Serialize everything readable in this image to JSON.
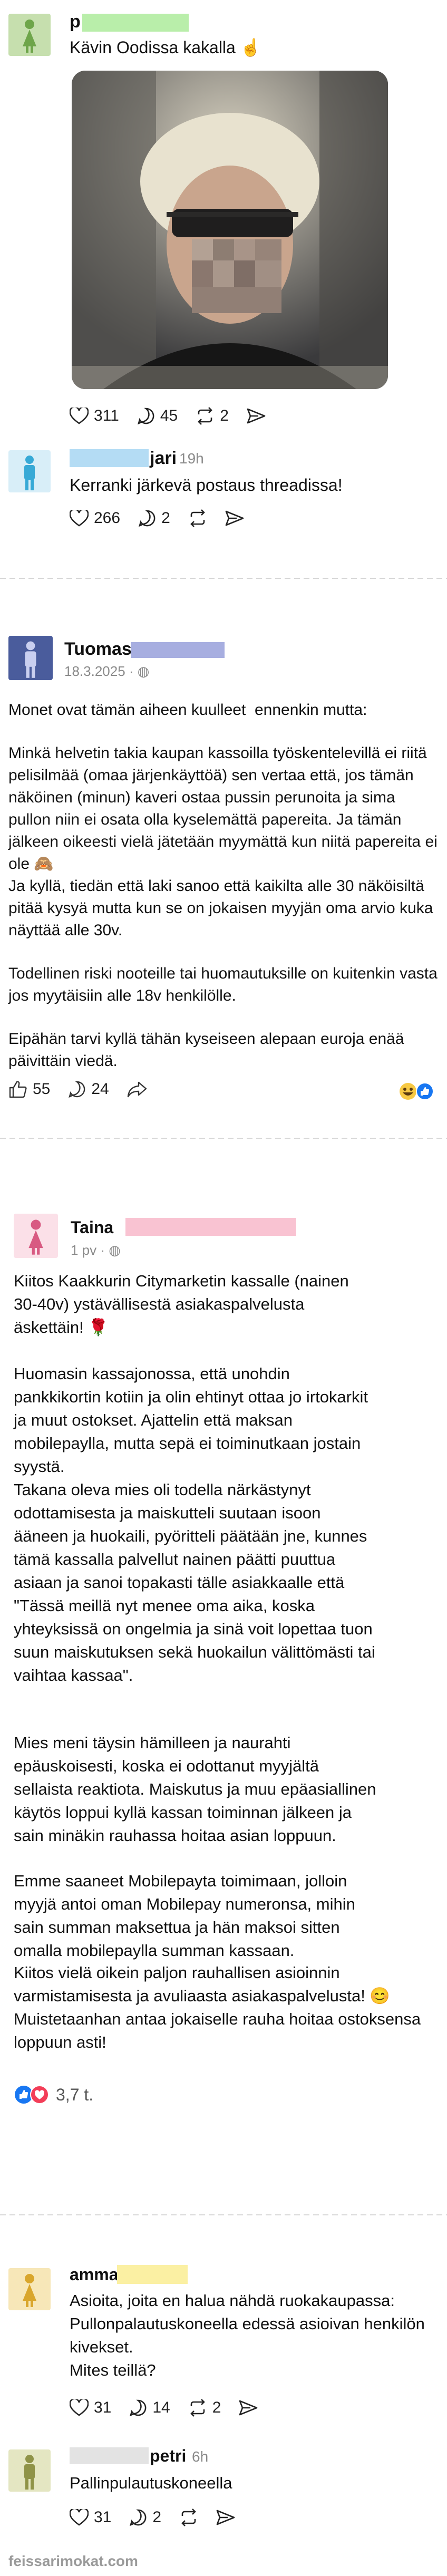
{
  "post1": {
    "name": "p",
    "text": "Kävin Oodissa kakalla ☝️",
    "likes": "311",
    "comments": "45",
    "reposts": "2"
  },
  "reply1": {
    "name": "jari",
    "time": "19h",
    "text": "Kerranki järkevä postaus threadissa!",
    "likes": "266",
    "comments": "2"
  },
  "post2": {
    "name": "Tuomas",
    "date": "18.3.2025 · ",
    "paragraphs": [
      "Monet ovat tämän aiheen kuulleet  ennenkin mutta:",
      "Minkä helvetin takia kaupan kassoilla työskentelevillä ei riitä pelisilmää (omaa järjenkäyttöä) sen vertaa että, jos tämän näköinen (minun) kaveri ostaa pussin perunoita ja sima pullon niin ei osata olla kyselemättä papereita. Ja tämän jälkeen oikeesti vielä jätetään myymättä kun niitä papereita ei ole 🙈",
      "Ja kyllä, tiedän että laki sanoo että kaikilta alle 30 näköisiltä pitää kysyä mutta kun se on jokaisen myyjän oma arvio kuka näyttää alle 30v.",
      "Todellinen riski nooteille tai huomautuksille on kuitenkin vasta jos myytäisiin alle 18v henkilölle.",
      "Eipähän tarvi kyllä tähän kyseiseen alepaan euroja enää päivittäin viedä."
    ],
    "likes": "55",
    "comments": "24"
  },
  "post3": {
    "name": "Taina",
    "date": "1 pv · ",
    "paragraphs": [
      "Kiitos Kaakkurin Citymarketin kassalle (nainen 30-40v) ystävällisestä asiakaspalvelusta äskettäin! 🌹",
      "Huomasin kassajonossa, että unohdin pankkikortin kotiin ja olin ehtinyt ottaa jo irtokarkit ja muut ostokset. Ajattelin että maksan mobilepaylla, mutta sepä ei toiminutkaan jostain syystä.",
      "Takana oleva mies oli todella närkästynyt odottamisesta ja maiskutteli suutaan isoon ääneen ja huokaili, pyöritteli päätään jne, kunnes tämä kassalla palvellut nainen päätti puuttua asiaan ja sanoi topakasti tälle asiakkaalle että \"Tässä meillä nyt menee oma aika, koska yhteyksissä on ongelmia ja sinä voit lopettaa tuon suun maiskutuksen sekä huokailun välittömästi tai vaihtaa kassaa\".",
      "Mies meni täysin hämilleen ja naurahti epäuskoisesti, koska ei odottanut myyjältä sellaista reaktiota. Maiskutus ja muu epäasiallinen käytös loppui kyllä kassan toiminnan jälkeen ja sain minäkin rauhassa hoitaa asian loppuun.",
      "Emme saaneet Mobilepayta toimimaan, jolloin myyjä antoi oman Mobilepay numeronsa, mihin sain summan maksettua ja hän maksoi sitten omalla mobilepaylla summan kassaan.",
      "Kiitos vielä oikein paljon rauhallisen asioinnin varmistamisesta ja avuliaasta asiakaspalvelusta! 😊 Muistetaanhan antaa jokaiselle rauha hoitaa ostoksensa loppuun asti!"
    ],
    "reactions": "3,7 t."
  },
  "post4": {
    "name": "amma",
    "text": "Asioita, joita en halua nähdä ruokakaupassa:\nPullonpalautuskoneella edessä asioivan henkilön kivekset.\nMites teillä?",
    "likes": "31",
    "comments": "14",
    "reposts": "2"
  },
  "reply4": {
    "name": "petri",
    "time": "6h",
    "text": "Pallinpulautuskoneella",
    "likes": "31",
    "comments": "2"
  },
  "footer": {
    "watermark": "feissarimokat.com"
  },
  "colors": {
    "avatar_female_green": "#a9c98a",
    "avatar_male_blue": "#37a9d6",
    "avatar_male_navy": "#4a5c9c",
    "avatar_female_pink": "#d85a82",
    "avatar_female_yellow": "#e3b43a",
    "avatar_male_olive": "#9ea15a",
    "redact_green": "#b9eeaa",
    "redact_blue": "#b4dcf4",
    "redact_navy": "#a7aee0",
    "redact_pink": "#f9c3d2",
    "redact_yellow": "#fbf0a3"
  }
}
